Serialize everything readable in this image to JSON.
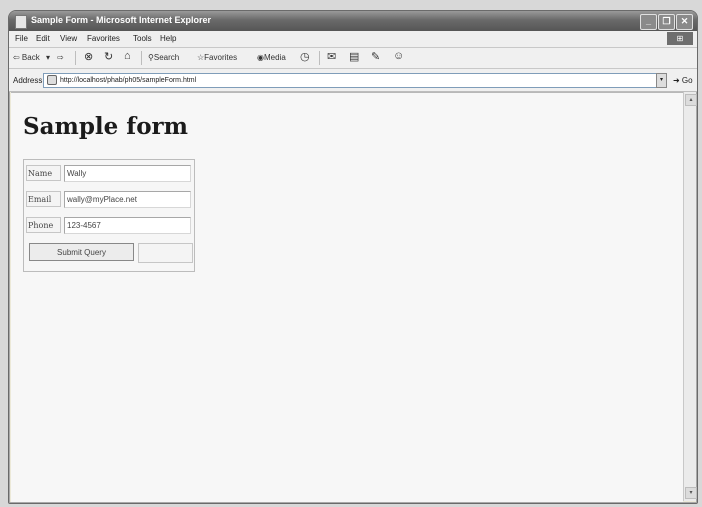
{
  "window": {
    "title": "Sample Form - Microsoft Internet Explorer",
    "controls": {
      "minimize": "_",
      "maximize": "❐",
      "close": "✕"
    }
  },
  "menubar": {
    "items": [
      "File",
      "Edit",
      "View",
      "Favorites",
      "Tools",
      "Help"
    ]
  },
  "toolbar": {
    "back": "⇦ Back",
    "back_drop": "▾",
    "forward": "⇨",
    "stop": "⊗",
    "refresh": "↻",
    "home": "⌂",
    "search": "Search",
    "favorites": "Favorites",
    "media": "Media",
    "history": "◷",
    "mail": "✉",
    "print": "▤",
    "edit": "✎",
    "discuss": "☺"
  },
  "address": {
    "label": "Address",
    "url": "http://localhost/phab/ph05/sampleForm.html",
    "dropdown": "▾",
    "go": "➜ Go"
  },
  "page": {
    "heading": "Sample form",
    "form": {
      "name_label": "Name",
      "name_value": "Wally",
      "email_label": "Email",
      "email_value": "wally@myPlace.net",
      "phone_label": "Phone",
      "phone_value": "123-4567",
      "submit_label": "Submit Query"
    }
  },
  "scrollbar": {
    "up": "▴",
    "down": "▾"
  }
}
